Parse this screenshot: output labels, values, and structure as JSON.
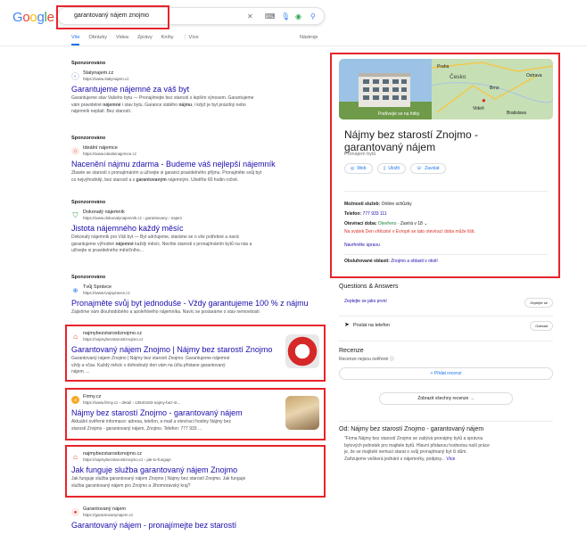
{
  "logo": "Google",
  "search": {
    "query": "garantovaný nájem znojmo"
  },
  "tabs": [
    "Vše",
    "Obrázky",
    "Videa",
    "Zprávy",
    "Knihy",
    "Více"
  ],
  "tools": "Nástroje",
  "results": [
    {
      "sponsored": "Sponzorováno",
      "name": "Stalynajem.cz",
      "url": "https://www.stalynajem.cz",
      "title": "Garantujeme nájemné za váš byt",
      "snippet_1": "Garantujeme stav Vašeho bytu — Pronajímejte bez starostí s lepším výnosem. Garantujeme",
      "snippet_2a": "vám pravidelné ",
      "snippet_2b": "nájemné",
      "snippet_2c": " i stav bytu. Garance stálého ",
      "snippet_2d": "nájmu",
      "snippet_2e": ", i když je byt prázdný nebo",
      "snippet_3": "nájemník neplatí. Bez starostí."
    },
    {
      "sponsored": "Sponzorováno",
      "name": "Ideální nájemce",
      "url": "https://www.idealninajemce.cz",
      "title": "Nacenění nájmu zdarma - Budeme váš nejlepší nájemník",
      "snippet_1": "Zbavte se starostí s pronajímáním a užívejte si garanci pravidelného příjmu. Pronajměte svůj byt",
      "snippet_2a": "co nejvýhodněji, bez starostí a s ",
      "snippet_2b": "garantovaným",
      "snippet_2c": " nájemným. Ušetříte 60 hodin ročně."
    },
    {
      "sponsored": "Sponzorováno",
      "name": "Dokonalý nájemník",
      "url": "https://www.dokonalynajemnik.cz › garantovany › najem",
      "title": "Jistota nájemného každý měsíc",
      "snippet_1": "Dokonalý nájemník pro Váš byt — Byt udržujeme, staráme se o vše potřebné a navíc",
      "snippet_2a": "garantujeme výhodné ",
      "snippet_2b": "nájemné",
      "snippet_2c": " každý měsíc. Nechte starosti s pronajímáním bytů na nás a",
      "snippet_3": "užívejte si pravidelného měsíčního..."
    },
    {
      "sponsored": "Sponzorováno",
      "name": "Tvůj Správce",
      "url": "https://www.tvujspravce.cz",
      "title": "Pronajměte svůj byt jednoduše - Vždy garantujeme 100 % z nájmu",
      "snippet_1": "Zajistíme vám dlouhodobého a spolehlivého nájemníka. Navíc se postaráme o stav nemovitosti"
    },
    {
      "name": "najmybezstarostiznojmo.cz",
      "url": "https://najmybezstarostiznojmo.cz",
      "title": "Garantovaný nájem Znojmo | Nájmy bez starostí Znojmo",
      "snippet_1": "Garantovaný nájem Znojmo | Nájmy bez starostí Znojmo. Garantujeme nájemné",
      "snippet_2": "vždy a včas. Každý měsíc v dohodnutý den vám na účtu přistane garantovaný",
      "snippet_3": "nájem. ..."
    },
    {
      "name": "Firmy.cz",
      "url": "https://www.firmy.cz › detail › 13540183-najmy-bez-st...",
      "title": "Nájmy bez starostí Znojmo - garantovaný nájem",
      "snippet_1": "Aktuální ověřené informace: adresa, telefon, e-mail a otevírací hodiny Nájmy bez",
      "snippet_2": "starostí Znojmo - garantovaný nájem, Znojmo. Telefon: 777 933 ..."
    },
    {
      "name": "najmybezstarostiznojmo.cz",
      "url": "https://najmybezstarostiznojmo.cz › jak-to-funguje",
      "title": "Jak funguje služba garantovaný nájem Znojmo",
      "snippet_1": "Jak funguje služba garantovaný nájem Znojmo | Nájmy bez starostí Znojmo. Jak funguje",
      "snippet_2": "služba garantovaný nájem pro Znojmo a Jihomoravský kraj?"
    },
    {
      "name": "Garantovaný nájem",
      "url": "https://garantovanynajem.cz",
      "title": "Garantovaný nájem - pronajímejte bez starostí"
    }
  ],
  "kp": {
    "photo_caption": "Podívejte se na fotky",
    "map_labels": [
      "Praha",
      "Česko",
      "Ostrava",
      "Brno",
      "Videň",
      "Bratislava"
    ],
    "title_line1": "Nájmy bez starostí Znojmo -",
    "title_line2": "garantovaný nájem",
    "subtitle": "Pronájem bytů",
    "buttons": [
      "Web",
      "Uložit",
      "Zavolat"
    ],
    "services_label": "Možnosti služeb:",
    "services_value": " Online schůzky",
    "phone_label": "Telefon:",
    "phone_value": "777 933 111",
    "hours_label": "Otevírací doba:",
    "hours_open": " Otevřeno",
    "hours_close": " · Zavírá v 18 ",
    "holiday_note": "Na svátek Den vítězství v Evropě se tato otevírací doba může lišit.",
    "suggest_edit": "Navrhněte úpravu",
    "area_label": "Obsluhované oblasti:",
    "area_value": "Znojmo a oblasti v okolí"
  },
  "qa": {
    "title": "Questions & Answers",
    "ask": "Zeptejte se jako první",
    "ask_btn": "Zeptejte se"
  },
  "send": {
    "label": "Poslat na telefon",
    "btn": "Odeslat"
  },
  "reviews": {
    "title": "Recenze",
    "note": "Recenze nejsou ověřené",
    "add": "Přidat recenzi",
    "show_all": "Zobrazit všechny recenze"
  },
  "about": {
    "title": "Od: Nájmy bez starostí Znojmo - garantovaný nájem",
    "line1": "\"Firma Nájmy bez starostí Znojmo se zabývá pronájmy bytů a správou",
    "line2": "bytových jednotek pro majitele bytů. Hlavní přidanou hodnotou naší práce",
    "line3": "je, že se majitelé nemusí starat o svůj pronajímaný byt či dům.",
    "line4": "Zařizujeme veškerá jednání s nájemníky, podpisy...",
    "more": "Více"
  },
  "colors": {
    "accent": "#1a73e8",
    "link": "#1a0dab",
    "highlight": "#e8242b"
  }
}
